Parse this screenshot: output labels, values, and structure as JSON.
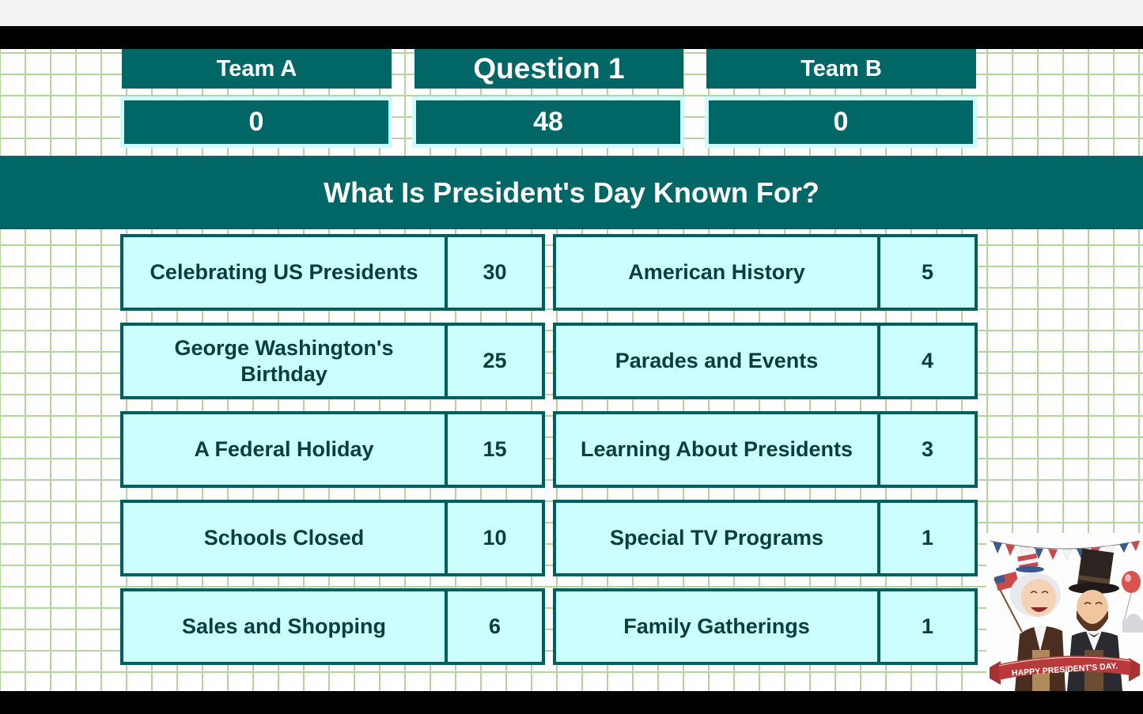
{
  "scoreboard": {
    "team_a": {
      "label": "Team A",
      "score": "0"
    },
    "question": {
      "label": "Question 1",
      "value": "48"
    },
    "team_b": {
      "label": "Team B",
      "score": "0"
    }
  },
  "question_text": "What Is President's Day Known For?",
  "answers": [
    {
      "label": "Celebrating US Presidents",
      "points": "30"
    },
    {
      "label": "George Washington's Birthday",
      "points": "25"
    },
    {
      "label": "A Federal Holiday",
      "points": "15"
    },
    {
      "label": "Schools Closed",
      "points": "10"
    },
    {
      "label": "Sales and Shopping",
      "points": "6"
    },
    {
      "label": "American History",
      "points": "5"
    },
    {
      "label": "Parades and Events",
      "points": "4"
    },
    {
      "label": "Learning About Presidents",
      "points": "3"
    },
    {
      "label": "Special TV Programs",
      "points": "1"
    },
    {
      "label": "Family Gatherings",
      "points": "1"
    }
  ],
  "illustration": {
    "banner_text": "HAPPY PRESIDENT'S DAY.",
    "icon": "presidents-day-illustration"
  },
  "colors": {
    "teal": "#006766",
    "answer_fill": "#ccfefe",
    "answer_border": "#005f5e",
    "grid_line": "#b3d39f",
    "score_border": "#ccfcfc"
  }
}
